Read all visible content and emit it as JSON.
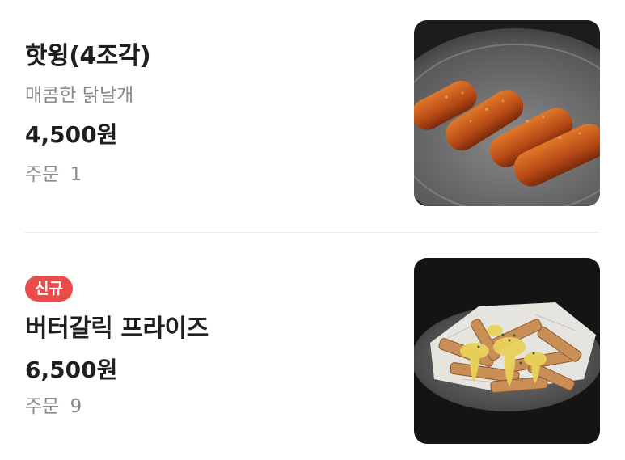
{
  "menu": {
    "items": [
      {
        "name": "핫윙(4조각)",
        "description": "매콤한 닭날개",
        "price": "4,500원",
        "orders_label": "주문",
        "orders_count": "1",
        "image_icon": "chicken-wings-photo"
      },
      {
        "badge": "신규",
        "name": "버터갈릭 프라이즈",
        "price": "6,500원",
        "orders_label": "주문",
        "orders_count": "9",
        "image_icon": "garlic-fries-photo"
      }
    ]
  },
  "colors": {
    "badge_bg": "#ea4c4a",
    "text_primary": "#1f1f1f",
    "text_secondary": "#8a8a8a",
    "divider": "#ececec"
  }
}
